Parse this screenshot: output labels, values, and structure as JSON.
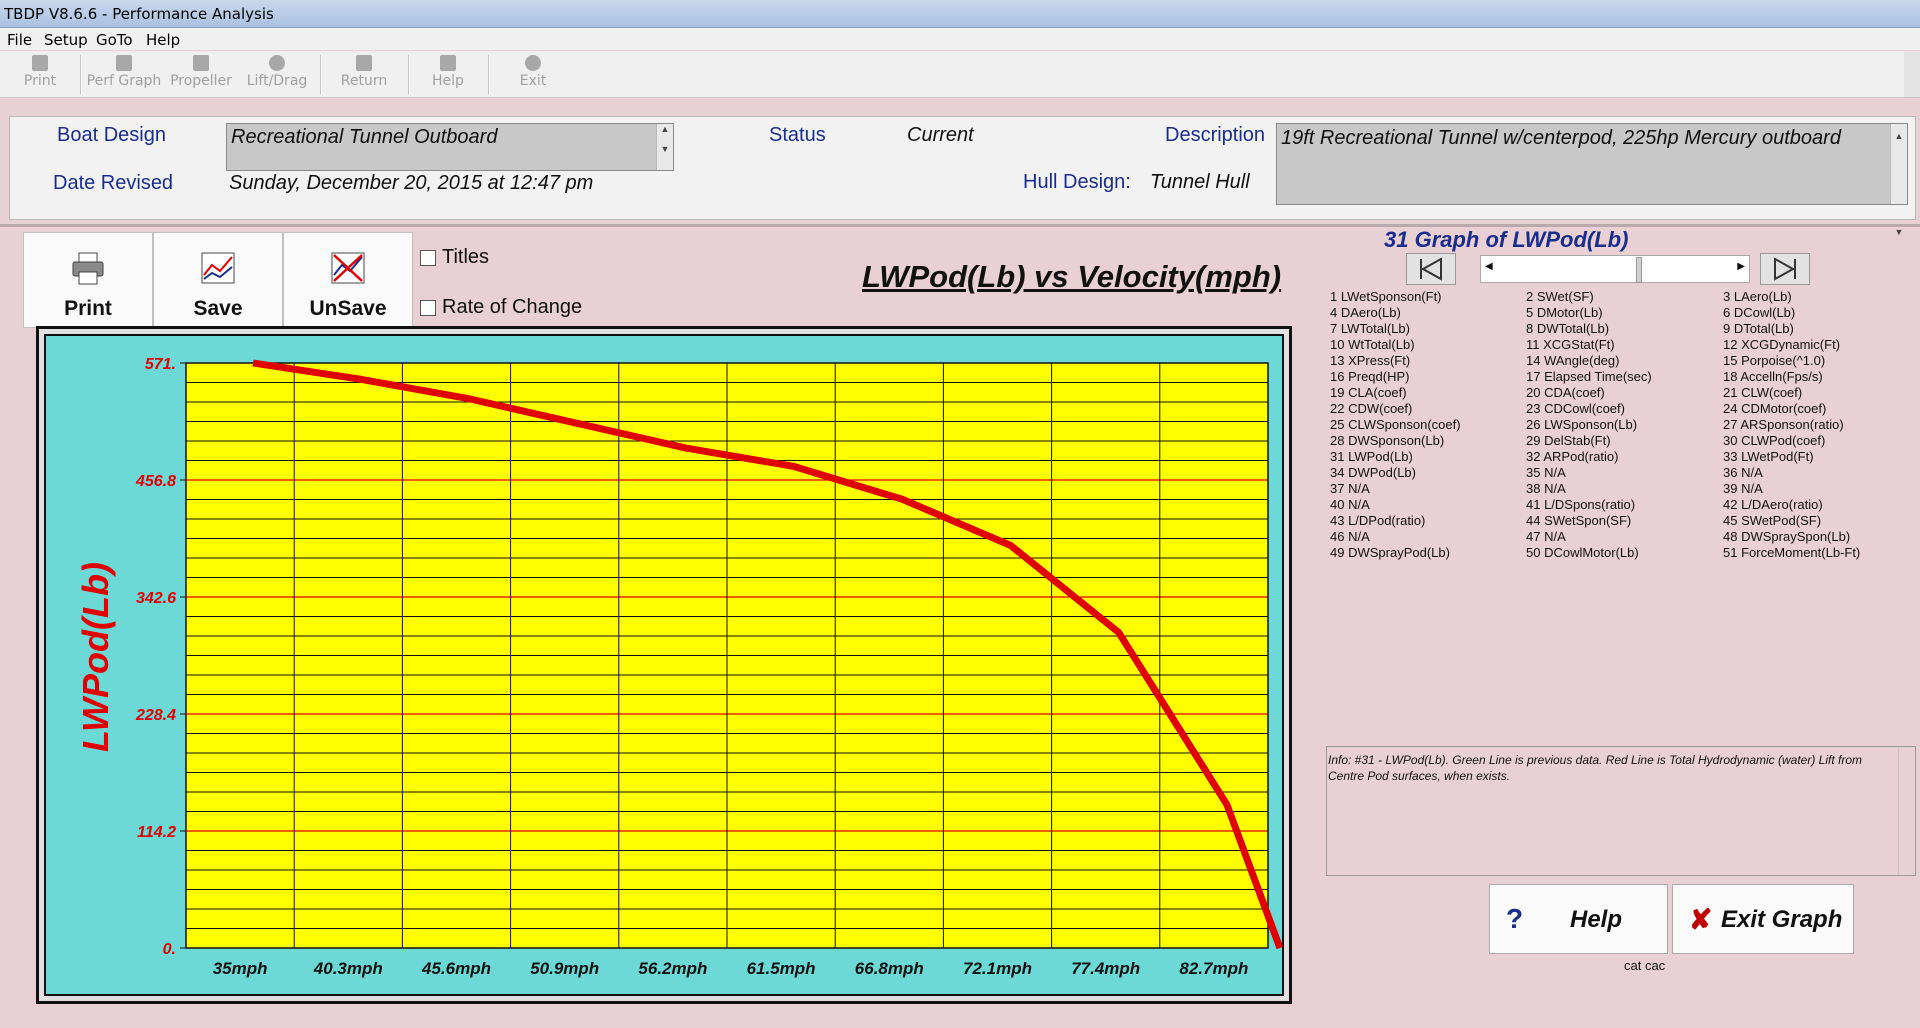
{
  "window": {
    "title": "TBDP V8.6.6 - Performance Analysis"
  },
  "menu": [
    "File",
    "Setup",
    "GoTo",
    "Help"
  ],
  "toolbar": [
    "Print",
    "Perf Graph",
    "Propeller",
    "Lift/Drag",
    "Return",
    "Help",
    "Exit"
  ],
  "info": {
    "boat_design_label": "Boat Design",
    "boat_design_value": "Recreational Tunnel Outboard",
    "date_revised_label": "Date Revised",
    "date_revised_value": "Sunday, December 20, 2015 at 12:47 pm",
    "status_label": "Status",
    "status_value": "Current",
    "hull_design_label": "Hull Design:",
    "hull_design_value": "Tunnel Hull",
    "description_label": "Description",
    "description_value": "19ft Recreational Tunnel w/centerpod, 225hp Mercury outboard"
  },
  "graph_controls": {
    "print_label": "Print",
    "save_label": "Save",
    "unsave_label": "UnSave",
    "titles_label": "Titles",
    "rate_label": "Rate of Change"
  },
  "colors": {
    "plot_bg": "#ffff00",
    "frame_bg": "#6cd9d6",
    "line": "#e00000",
    "axis_text": "#e00000"
  },
  "chart_data": {
    "type": "line",
    "title": "LWPod(Lb) vs Velocity(mph)",
    "ylabel": "LWPod(Lb)",
    "categories": [
      "35mph",
      "40.3mph",
      "45.6mph",
      "50.9mph",
      "56.2mph",
      "61.5mph",
      "66.8mph",
      "72.1mph",
      "77.4mph",
      "82.7mph"
    ],
    "x": [
      35,
      40.3,
      45.6,
      50.9,
      56.2,
      61.5,
      66.8,
      72.1,
      77.4,
      82.7,
      85.3
    ],
    "values": [
      571,
      555,
      536,
      512,
      488,
      470,
      438,
      393,
      308,
      140,
      0
    ],
    "yticks": [
      "571.",
      "456.8",
      "342.6",
      "228.4",
      "114.2",
      "0."
    ],
    "ylim": [
      0,
      571
    ],
    "xlim": [
      35,
      88
    ],
    "grid": true
  },
  "graph_list": {
    "title": "31 Graph of LWPod(Lb)",
    "items": [
      "1 LWetSponson(Ft)",
      "2 SWet(SF)",
      "3 LAero(Lb)",
      "4 DAero(Lb)",
      "5 DMotor(Lb)",
      "6 DCowl(Lb)",
      "7 LWTotal(Lb)",
      "8 DWTotal(Lb)",
      "9 DTotal(Lb)",
      "10 WtTotal(Lb)",
      "11 XCGStat(Ft)",
      "12 XCGDynamic(Ft)",
      "13 XPress(Ft)",
      "14 WAngle(deg)",
      "15 Porpoise(^1.0)",
      "16 Preqd(HP)",
      "17 Elapsed Time(sec)",
      "18 Accelln(Fps/s)",
      "19 CLA(coef)",
      "20 CDA(coef)",
      "21 CLW(coef)",
      "22 CDW(coef)",
      "23 CDCowl(coef)",
      "24 CDMotor(coef)",
      "25 CLWSponson(coef)",
      "26 LWSponson(Lb)",
      "27 ARSponson(ratio)",
      "28 DWSponson(Lb)",
      "29 DelStab(Ft)",
      "30 CLWPod(coef)",
      "31 LWPod(Lb)",
      "32 ARPod(ratio)",
      "33 LWetPod(Ft)",
      "34 DWPod(Lb)",
      "35 N/A",
      "36 N/A",
      "37 N/A",
      "38 N/A",
      "39 N/A",
      "40 N/A",
      "41 L/DSpons(ratio)",
      "42 L/DAero(ratio)",
      "43 L/DPod(ratio)",
      "44 SWetSpon(SF)",
      "45 SWetPod(SF)",
      "46 N/A",
      "47 N/A",
      "48 DWSpraySpon(Lb)",
      "49 DWSprayPod(Lb)",
      "50 DCowlMotor(Lb)",
      "51 ForceMoment(Lb-Ft)"
    ]
  },
  "info_text": "Info: #31 - LWPod(Lb). Green Line is previous data. Red Line is Total Hydrodynamic (water) Lift from Centre Pod surfaces, when exists.",
  "buttons": {
    "help": "Help",
    "exit": "Exit Graph"
  },
  "footer_note": "cat cac"
}
